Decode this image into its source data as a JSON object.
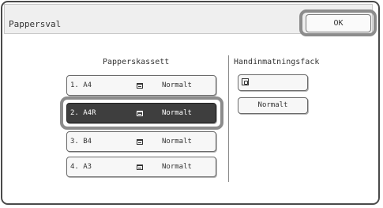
{
  "header": {
    "title": "Pappersval",
    "ok_label": "OK"
  },
  "trays": {
    "heading": "Papperskassett",
    "items": [
      {
        "label": "1. A4",
        "type": "Normalt",
        "icon": "paper-tray-icon",
        "selected": false
      },
      {
        "label": "2. A4R",
        "type": "Normalt",
        "icon": "paper-tray-icon",
        "selected": true
      },
      {
        "label": "3. B4",
        "type": "Normalt",
        "icon": "paper-tray-icon",
        "selected": false
      },
      {
        "label": "4. A3",
        "type": "Normalt",
        "icon": "paper-tray-icon",
        "selected": false
      }
    ]
  },
  "manual": {
    "heading": "Handinmatningsfack",
    "icon": "bypass-tray-icon",
    "type": "Normalt"
  },
  "colors": {
    "selected_bg": "#3e3e3e",
    "highlight_ring": "#8c8c8c",
    "titlebar_bg": "#efefef"
  }
}
